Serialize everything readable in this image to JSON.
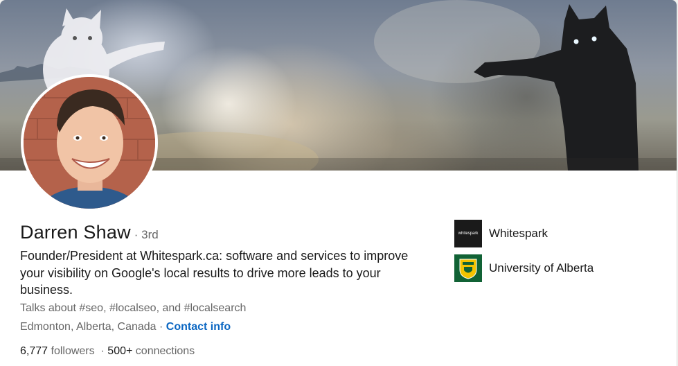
{
  "profile": {
    "name": "Darren Shaw",
    "degree": "· 3rd",
    "headline": "Founder/President at Whitespark.ca: software and services to improve your visibility on Google's local results to drive more leads to your business.",
    "talks_about": "Talks about #seo, #localseo, and #localsearch",
    "location": "Edmonton, Alberta, Canada",
    "location_sep": " · ",
    "contact_link": "Contact info",
    "followers_count": "6,777",
    "followers_label": " followers",
    "stats_sep": "  · ",
    "connections_count": "500+",
    "connections_label": " connections"
  },
  "organizations": [
    {
      "name": "Whitespark",
      "logo_text": "whitespark",
      "icon": "whitespark-logo"
    },
    {
      "name": "University of Alberta",
      "icon": "university-of-alberta-crest"
    }
  ],
  "colors": {
    "link": "#0a66c2",
    "text_primary": "#191919",
    "text_secondary": "#666666",
    "ua_green": "#116235"
  }
}
